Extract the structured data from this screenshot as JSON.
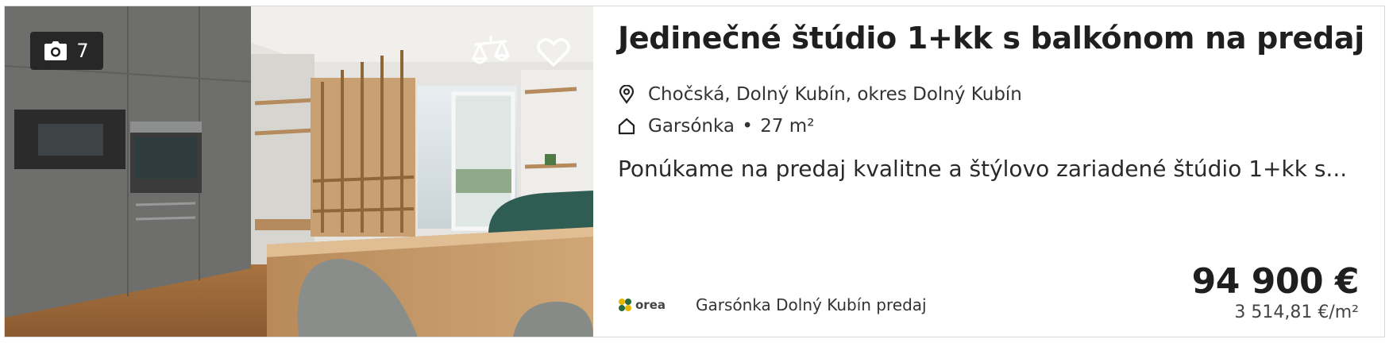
{
  "listing": {
    "title": "Jedinečné štúdio 1+kk s balkónom na predaj",
    "photo_count": "7",
    "location": "Chočská, Dolný Kubín, okres Dolný Kubín",
    "property_type": "Garsónka",
    "area": "27 m²",
    "description": "Ponúkame na predaj kvalitne a štýlovo zariadené štúdio 1+kk s...",
    "price": "94 900 €",
    "price_per_m2": "3 514,81 €/m²"
  },
  "agency": {
    "logo_text": "orea",
    "label": "Garsónka Dolný Kubín predaj"
  },
  "icons": {
    "camera": "camera-icon",
    "compare": "scales-icon",
    "favorite": "heart-icon",
    "location": "map-pin-icon",
    "type": "house-icon"
  },
  "colors": {
    "text": "#222222",
    "badge_bg": "#1e1e1e",
    "border": "#d9d9d9"
  }
}
